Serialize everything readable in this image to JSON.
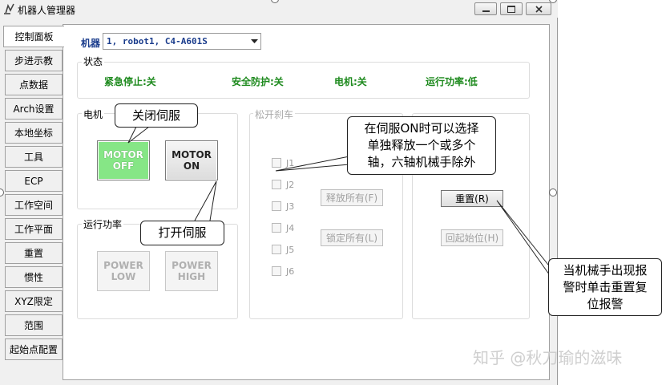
{
  "window": {
    "title": "机器人管理器"
  },
  "tabs": [
    "控制面板",
    "步进示教",
    "点数据",
    "Arch设置",
    "本地坐标",
    "工具",
    "ECP",
    "工作空间",
    "工作平面",
    "重置",
    "惯性",
    "XYZ限定",
    "范围",
    "起始点配置"
  ],
  "robot": {
    "label": "机器",
    "value": "1, robot1, C4-A601S"
  },
  "status": {
    "group_label": "状态",
    "estop": "紧急停止:关",
    "safeguard": "安全防护:关",
    "motor": "电机:关",
    "power": "运行功率:低"
  },
  "motor_group": {
    "label": "电机",
    "off_line1": "MOTOR",
    "off_line2": "OFF",
    "on_line1": "MOTOR",
    "on_line2": "ON",
    "off_color": "#86e686"
  },
  "power_group": {
    "label": "运行功率",
    "low_line1": "POWER",
    "low_line2": "LOW",
    "high_line1": "POWER",
    "high_line2": "HIGH"
  },
  "brake_group": {
    "label": "松开刹车",
    "joints": [
      "J1",
      "J2",
      "J3",
      "J4",
      "J5",
      "J6"
    ],
    "release_all": "释放所有(F)",
    "lock_all": "锁定所有(L)"
  },
  "right_group": {
    "reset": "重置(R)",
    "home": "回起始位(H)"
  },
  "callouts": {
    "close_servo": "关闭伺服",
    "open_servo": "打开伺服",
    "brake_note": [
      "在伺服ON时可以选择",
      "单独释放一个或多个",
      "轴，六轴机械手除外"
    ],
    "reset_note": [
      "当机械手出现报",
      "警时单击重置复",
      "位报警"
    ]
  },
  "watermark": "知乎 @秋刀瑜的滋味"
}
